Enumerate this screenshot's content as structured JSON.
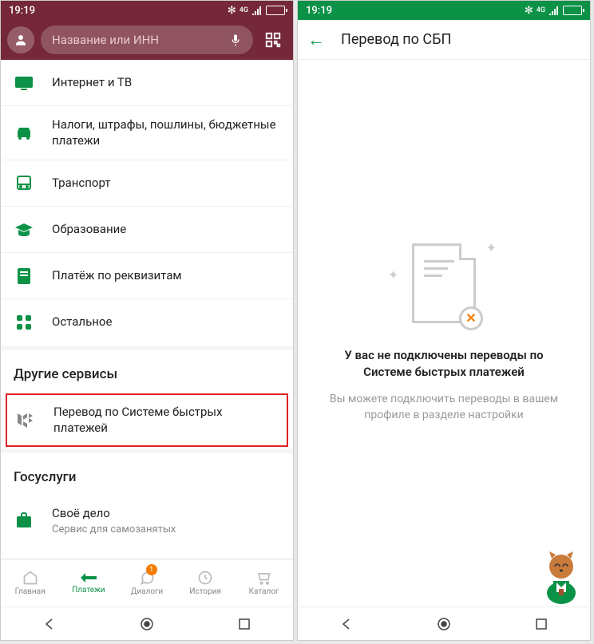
{
  "status": {
    "time": "19:19",
    "network": "4G"
  },
  "left": {
    "search": {
      "placeholder": "Название или ИНН"
    },
    "menu": [
      {
        "icon": "tv",
        "label": "Интернет и ТВ"
      },
      {
        "icon": "car",
        "label": "Налоги, штрафы, пошлины, бюджетные платежи"
      },
      {
        "icon": "bus",
        "label": "Транспорт"
      },
      {
        "icon": "grad",
        "label": "Образование"
      },
      {
        "icon": "receipt",
        "label": "Платёж по реквизитам"
      },
      {
        "icon": "grid",
        "label": "Остальное"
      }
    ],
    "section_other": "Другие сервисы",
    "sbp_item": {
      "label": "Перевод по Системе быстрых платежей"
    },
    "section_gos": "Госуслуги",
    "gos_item": {
      "label": "Своё дело",
      "sublabel": "Сервис для самозанятых"
    },
    "nav": [
      {
        "label": "Главная"
      },
      {
        "label": "Платежи"
      },
      {
        "label": "Диалоги",
        "badge": "1"
      },
      {
        "label": "История"
      },
      {
        "label": "Каталог"
      }
    ]
  },
  "right": {
    "title": "Перевод по СБП",
    "empty_title": "У вас не подключены переводы по Системе быстрых платежей",
    "empty_sub": "Вы можете подключить переводы в вашем профиле в разделе настройки"
  }
}
